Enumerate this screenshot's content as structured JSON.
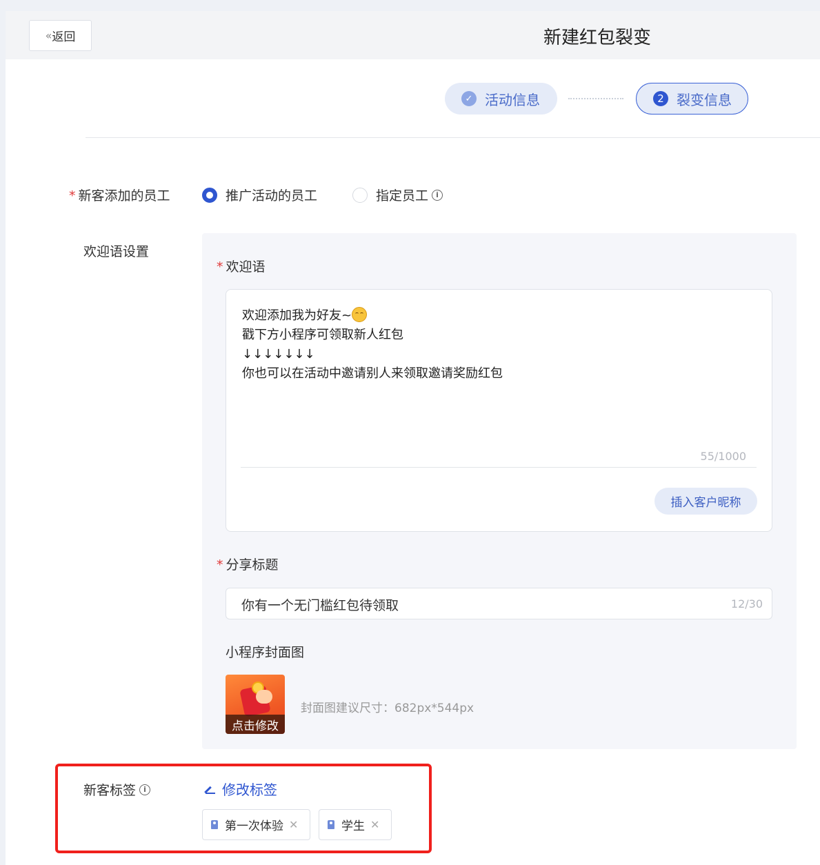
{
  "header": {
    "back_label": "返回",
    "title": "新建红包裂变"
  },
  "steps": [
    {
      "label": "活动信息",
      "icon": "check-icon",
      "state": "done"
    },
    {
      "label": "裂变信息",
      "number": "2",
      "state": "active"
    }
  ],
  "staff": {
    "label": "新客添加的员工",
    "options": [
      {
        "label": "推广活动的员工",
        "selected": true
      },
      {
        "label": "指定员工",
        "selected": false
      }
    ]
  },
  "welcome": {
    "section_label": "欢迎语设置",
    "field_label": "欢迎语",
    "lines": [
      "欢迎添加我为好友~",
      "戳下方小程序可领取新人红包",
      "↓↓↓↓↓↓↓",
      "你也可以在活动中邀请别人来领取邀请奖励红包"
    ],
    "counter": "55/1000",
    "insert_button": "插入客户昵称"
  },
  "share": {
    "label": "分享标题",
    "value": "你有一个无门槛红包待领取",
    "counter": "12/30"
  },
  "cover": {
    "label": "小程序封面图",
    "caption": "点击修改",
    "hint": "封面图建议尺寸：682px*544px"
  },
  "tags": {
    "label": "新客标签",
    "edit_label": "修改标签",
    "items": [
      "第一次体验",
      "学生"
    ]
  },
  "colors": {
    "primary": "#2f56d0",
    "step_bg": "#e5ebf8",
    "highlight": "#f0201c",
    "required": "#e03a3a"
  }
}
